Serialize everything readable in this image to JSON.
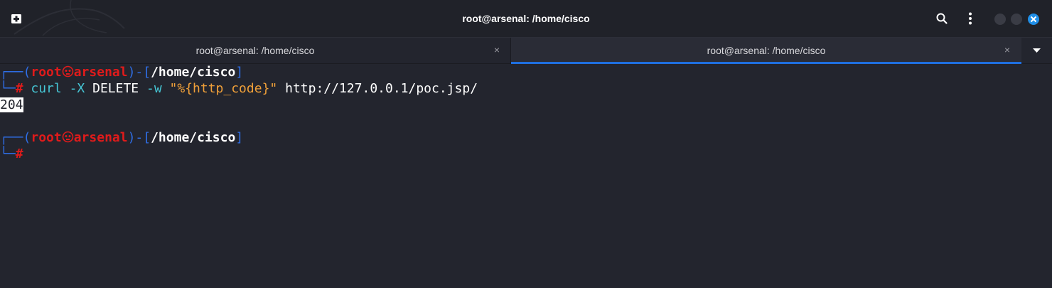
{
  "window": {
    "title": "root@arsenal: /home/cisco"
  },
  "tabs": [
    {
      "label": "root@arsenal: /home/cisco",
      "active": false
    },
    {
      "label": "root@arsenal: /home/cisco",
      "active": true
    }
  ],
  "terminal": {
    "prompt": {
      "user": "root",
      "host": "arsenal",
      "path": "/home/cisco",
      "symbol": "#"
    },
    "command": {
      "program": "curl",
      "flag1": "-X",
      "method": "DELETE",
      "flag2": "-w",
      "format_open": "\"%",
      "format_var": "{http_code}",
      "format_close": "\"",
      "url": "http://127.0.0.1/poc.jsp/"
    },
    "output": "204"
  },
  "colors": {
    "background": "#23252e",
    "prompt_frame": "#2f6ee6",
    "prompt_user": "#e01b1b",
    "command": "#46c7d6",
    "string": "#f0a039",
    "active_tab_indicator": "#1f6fe0"
  },
  "icons": [
    "new-tab-icon",
    "search-icon",
    "menu-dots-icon",
    "minimize-icon",
    "maximize-icon",
    "close-icon",
    "chevron-down-icon",
    "skull-icon"
  ]
}
